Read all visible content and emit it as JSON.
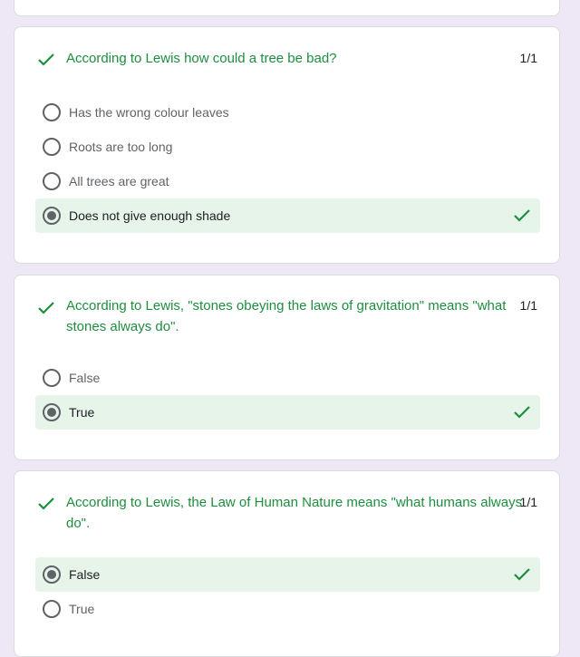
{
  "colors": {
    "background": "#ede7f6",
    "correct": "#1e8e3e",
    "correct_bg": "#e6f4ea"
  },
  "questions": [
    {
      "text": "According to Lewis how could a tree be bad?",
      "score": "1/1",
      "options": [
        {
          "label": "Has the wrong colour leaves",
          "selected": false,
          "correct": false
        },
        {
          "label": "Roots are too long",
          "selected": false,
          "correct": false
        },
        {
          "label": "All trees are great",
          "selected": false,
          "correct": false
        },
        {
          "label": "Does not give enough shade",
          "selected": true,
          "correct": true
        }
      ]
    },
    {
      "text": "According to Lewis, \"stones obeying the laws of gravitation\" means \"what stones always do\".",
      "score": "1/1",
      "options": [
        {
          "label": "False",
          "selected": false,
          "correct": false
        },
        {
          "label": "True",
          "selected": true,
          "correct": true
        }
      ]
    },
    {
      "text": "According to Lewis, the Law of Human Nature means \"what humans always do\".",
      "score": "1/1",
      "options": [
        {
          "label": "False",
          "selected": true,
          "correct": true
        },
        {
          "label": "True",
          "selected": false,
          "correct": false
        }
      ]
    }
  ]
}
